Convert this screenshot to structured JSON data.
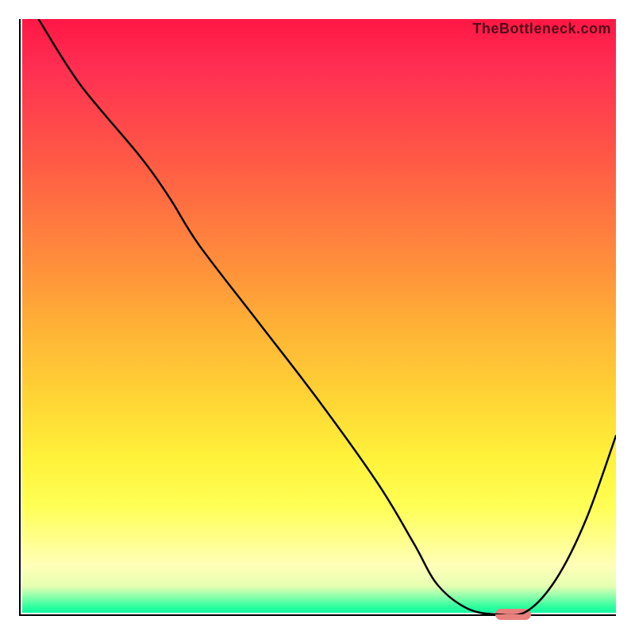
{
  "watermark": "TheBottleneck.com",
  "colors": {
    "top": "#ff1744",
    "mid": "#ffd535",
    "bottom": "#17f5a2",
    "line": "#000000",
    "highlight": "#e8807c",
    "axes": "#000000"
  },
  "chart_data": {
    "type": "line",
    "title": "",
    "xlabel": "",
    "ylabel": "",
    "xlim": [
      0,
      100
    ],
    "ylim": [
      0,
      100
    ],
    "grid": false,
    "legend": false,
    "x": [
      3,
      10,
      20,
      25,
      30,
      40,
      50,
      60,
      66,
      70,
      75,
      80,
      85,
      90,
      95,
      100
    ],
    "y": [
      100,
      89,
      77,
      70,
      62,
      49,
      36,
      22,
      12,
      5,
      1,
      0,
      0.5,
      6,
      16,
      30
    ],
    "highlight_x": [
      80,
      85
    ],
    "highlight_y": 0
  }
}
